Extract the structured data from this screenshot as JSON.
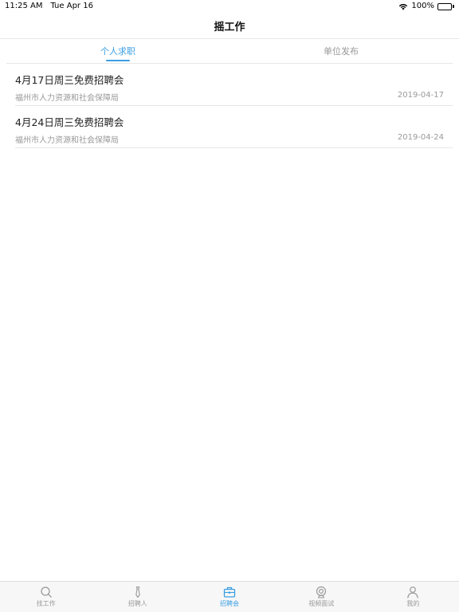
{
  "status_bar": {
    "time": "11:25 AM",
    "date": "Tue Apr 16",
    "battery": "100%"
  },
  "nav": {
    "title": "摇工作"
  },
  "tabs": [
    {
      "label": "个人求职",
      "active": true
    },
    {
      "label": "单位发布",
      "active": false
    }
  ],
  "list": [
    {
      "title": "4月17日周三免费招聘会",
      "org": "福州市人力资源和社会保障局",
      "date": "2019-04-17"
    },
    {
      "title": "4月24日周三免费招聘会",
      "org": "福州市人力资源和社会保障局",
      "date": "2019-04-24"
    }
  ],
  "tab_bar": [
    {
      "label": "找工作",
      "icon": "search-icon",
      "active": false
    },
    {
      "label": "招聘人",
      "icon": "tie-icon",
      "active": false
    },
    {
      "label": "招聘会",
      "icon": "briefcase-icon",
      "active": true
    },
    {
      "label": "视频面试",
      "icon": "webcam-icon",
      "active": false
    },
    {
      "label": "我的",
      "icon": "person-icon",
      "active": false
    }
  ],
  "colors": {
    "accent": "#3a9ee4",
    "inactive": "#999999",
    "divider": "#e6e6e6"
  }
}
